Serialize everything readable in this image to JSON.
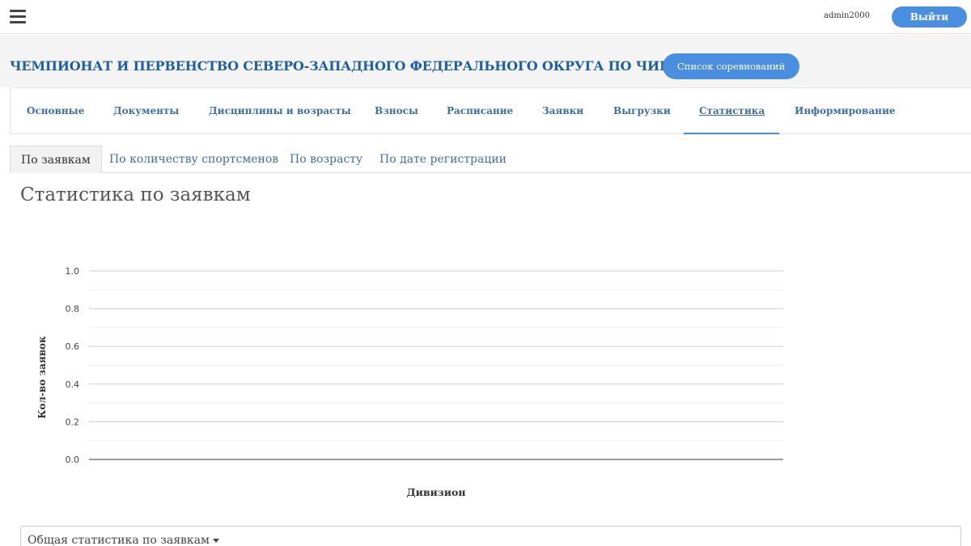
{
  "topbar": {
    "username": "admin2000",
    "logout_label": "Выйти"
  },
  "header": {
    "title": "ЧЕМПИОНАТ И ПЕРВЕНСТВО СЕВЕРО-ЗАПАДНОГО ФЕДЕРАЛЬНОГО ОКРУГА ПО ЧИР СПОРТУ",
    "competitions_button": "Список соревнований"
  },
  "main_nav": {
    "tabs": [
      {
        "label": "Основные"
      },
      {
        "label": "Документы"
      },
      {
        "label": "Дисциплины и возрасты"
      },
      {
        "label": "Взносы"
      },
      {
        "label": "Расписание"
      },
      {
        "label": "Заявки"
      },
      {
        "label": "Выгрузки"
      },
      {
        "label": "Статистика",
        "active": true
      },
      {
        "label": "Информирование"
      }
    ]
  },
  "sub_tabs": {
    "tabs": [
      {
        "label": "По заявкам",
        "active": true
      },
      {
        "label": "По количеству спортсменов"
      },
      {
        "label": "По возрасту"
      },
      {
        "label": "По дате регистрации"
      }
    ]
  },
  "section": {
    "title": "Статистика по заявкам"
  },
  "chart_data": {
    "type": "bar",
    "categories": [],
    "series": [],
    "xlabel": "Дивизион",
    "ylabel": "Кол-во заявок",
    "ylim": [
      0,
      1.0
    ],
    "yticks": [
      "0.0",
      "0.2",
      "0.4",
      "0.6",
      "0.8",
      "1.0"
    ],
    "grid": true
  },
  "dropdown": {
    "label": "Общая статистика по заявкам"
  },
  "colors": {
    "accent": "#4a8ee0",
    "title": "#1f5fa3",
    "link": "#3f6fa4"
  }
}
